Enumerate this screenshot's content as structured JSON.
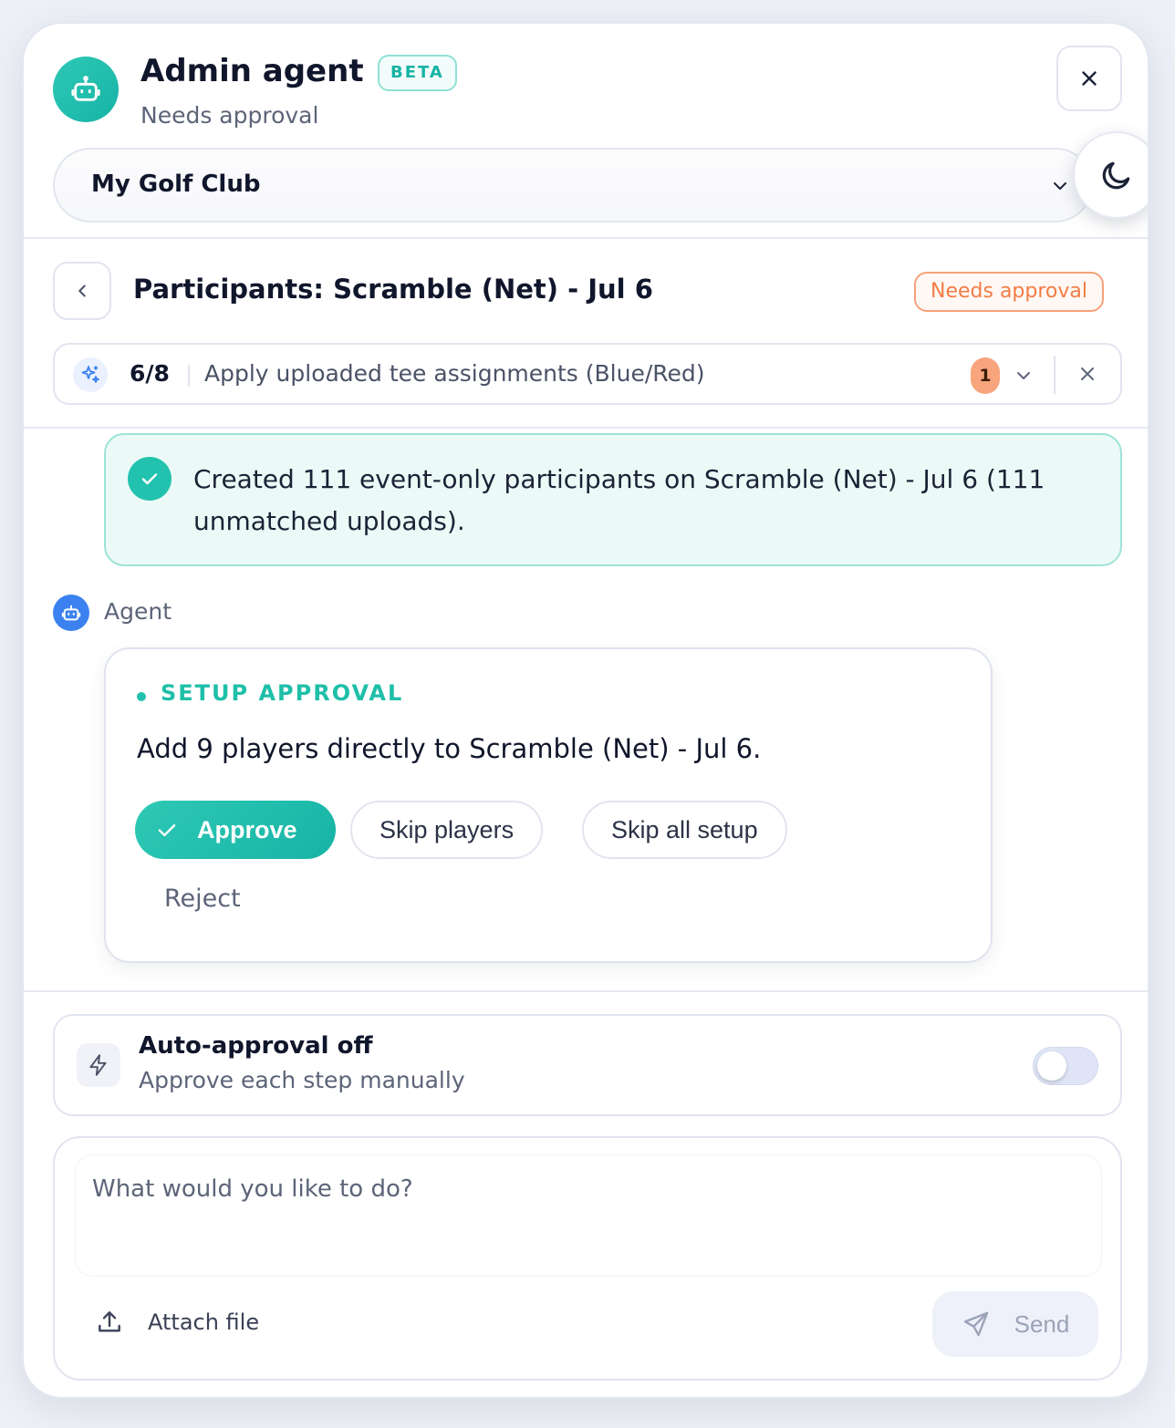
{
  "header": {
    "title": "Admin agent",
    "beta_label": "BETA",
    "subtitle": "Needs approval",
    "club_select_value": "My Golf Club"
  },
  "context": {
    "title": "Participants: Scramble (Net) - Jul 6",
    "status": "Needs approval",
    "task": {
      "progress": "6/8",
      "text": "Apply uploaded tee assignments (Blue/Red)",
      "count": "1"
    }
  },
  "feed": {
    "success_message": "Created 111 event-only participants on Scramble (Net) - Jul 6 (111 unmatched uploads).",
    "agent_label": "Agent",
    "approval": {
      "kicker": "SETUP APPROVAL",
      "text": "Add 9 players directly to Scramble (Net) - Jul 6.",
      "approve_label": "Approve",
      "skip_players_label": "Skip players",
      "skip_all_label": "Skip all setup",
      "reject_label": "Reject"
    }
  },
  "footer": {
    "auto_title": "Auto-approval off",
    "auto_sub": "Approve each step manually",
    "prompt_placeholder": "What would you like to do?",
    "attach_label": "Attach file",
    "send_label": "Send"
  },
  "colors": {
    "accent": "#22c2ae",
    "warning": "#f27c45",
    "agent_blue": "#3b82f0"
  },
  "icons": [
    "robot-icon",
    "close-icon",
    "chevron-down-icon",
    "moon-icon",
    "chevron-left-icon",
    "sparkles-icon",
    "check-icon",
    "lightning-icon",
    "upload-icon",
    "send-icon"
  ]
}
